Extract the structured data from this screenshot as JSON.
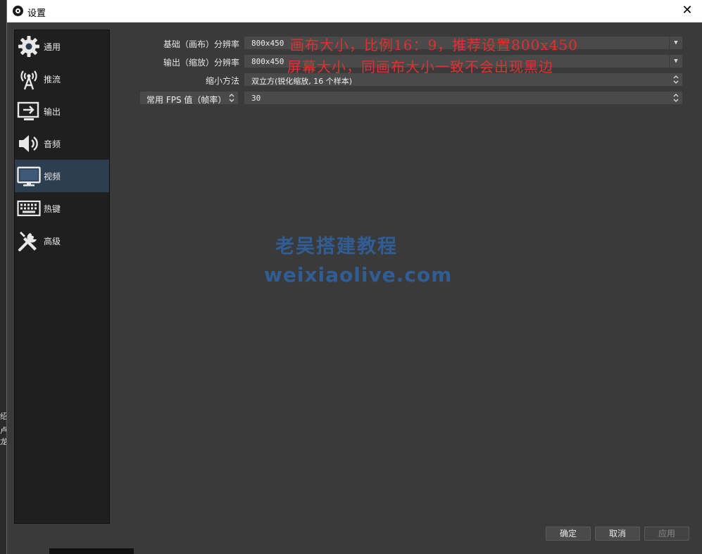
{
  "window": {
    "title": "设置"
  },
  "sidebar": {
    "items": [
      {
        "label": "通用",
        "icon": "gear-icon",
        "selected": false
      },
      {
        "label": "推流",
        "icon": "antenna-icon",
        "selected": false
      },
      {
        "label": "输出",
        "icon": "output-icon",
        "selected": false
      },
      {
        "label": "音频",
        "icon": "speaker-icon",
        "selected": false
      },
      {
        "label": "视频",
        "icon": "monitor-icon",
        "selected": true
      },
      {
        "label": "热键",
        "icon": "keyboard-icon",
        "selected": false
      },
      {
        "label": "高级",
        "icon": "tools-icon",
        "selected": false
      }
    ]
  },
  "video": {
    "base_resolution": {
      "label": "基础（画布）分辨率",
      "value": "800x450"
    },
    "output_resolution": {
      "label": "输出（缩放）分辨率",
      "value": "800x450"
    },
    "downscale_filter": {
      "label": "缩小方法",
      "value": "双立方(锐化缩放, 16 个样本)"
    },
    "fps": {
      "label": "常用 FPS 值（帧率）",
      "value": "30"
    }
  },
  "annotations": {
    "line1": "画布大小，比例16：9，推荐设置800x450",
    "line2": "屏幕大小，同画布大小一致不会出现黑边"
  },
  "watermark": {
    "line1": "老吴搭建教程",
    "line2": "weixiaolive.com"
  },
  "buttons": {
    "ok": "确定",
    "cancel": "取消",
    "apply": "应用"
  },
  "colors": {
    "selected": "#2c3e50",
    "annotation": "#e03030",
    "watermark": "#2f5f99"
  }
}
